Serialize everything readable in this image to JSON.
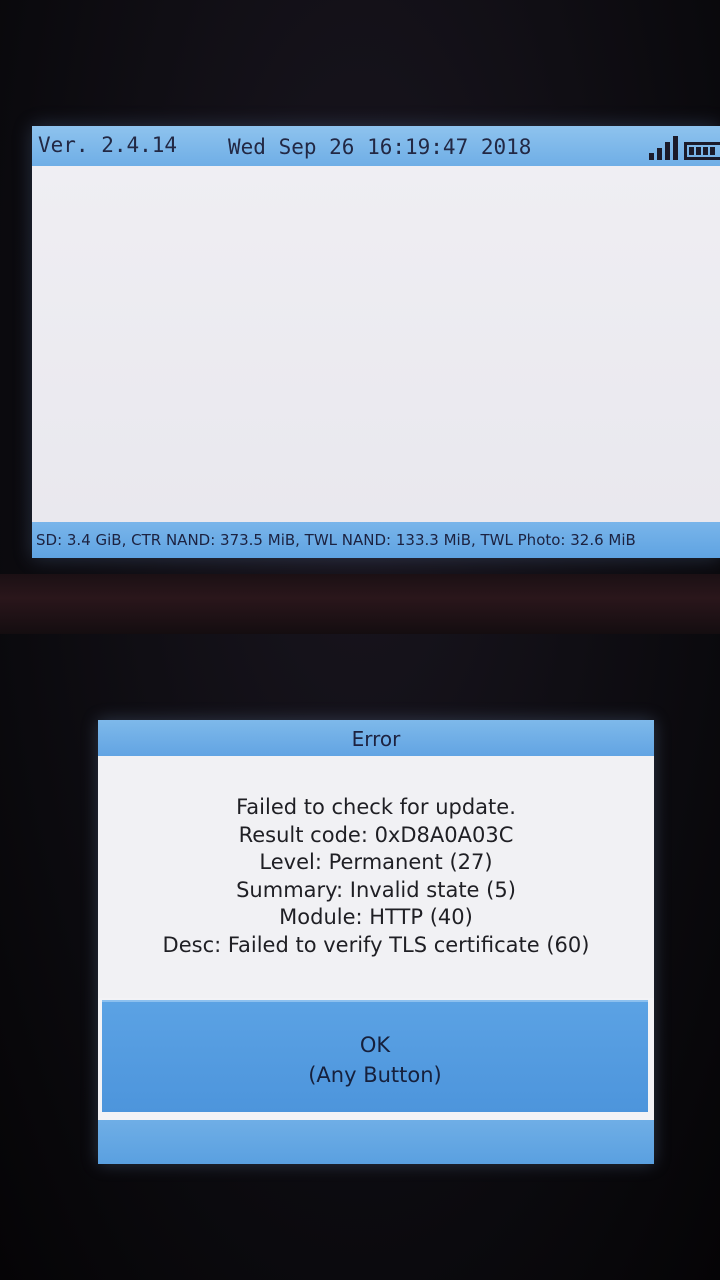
{
  "top_screen": {
    "version": "Ver. 2.4.14",
    "datetime": "Wed Sep 26 16:19:47 2018",
    "storage_info": "SD: 3.4 GiB, CTR NAND: 373.5 MiB, TWL NAND: 133.3 MiB, TWL Photo: 32.6 MiB",
    "icons": [
      "wifi-signal-icon",
      "battery-icon"
    ]
  },
  "dialog": {
    "title": "Error",
    "lines": [
      "Failed to check for update.",
      "Result code: 0xD8A0A03C",
      "Level: Permanent (27)",
      "Summary: Invalid state (5)",
      "Module: HTTP (40)",
      "Desc: Failed to verify TLS certificate (60)"
    ],
    "ok_label": "OK",
    "ok_hint": "(Any Button)"
  },
  "colors": {
    "accent_blue": "#6faee6",
    "button_blue": "#4d95dc",
    "screen_bg": "#f1f0f4"
  }
}
